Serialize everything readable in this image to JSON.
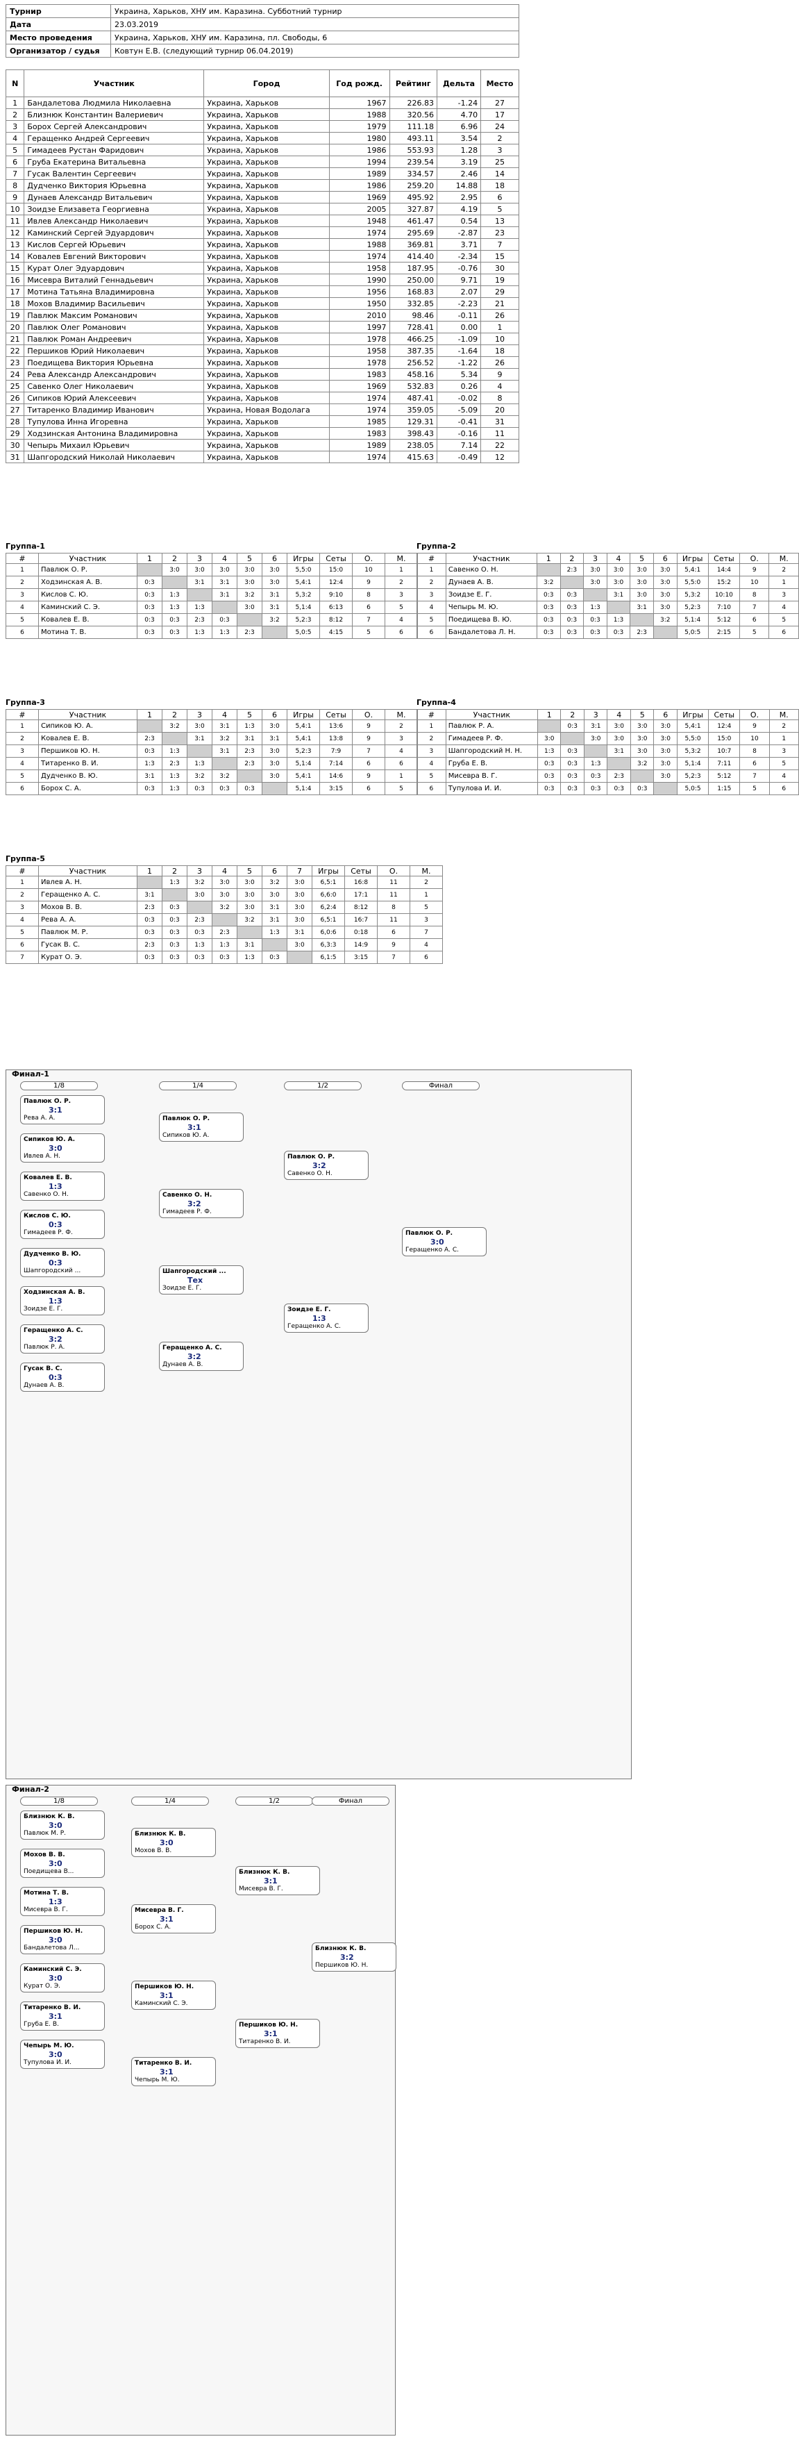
{
  "info": [
    {
      "label": "Турнир",
      "value": "Украина, Харьков, ХНУ им. Каразина. Субботний турнир"
    },
    {
      "label": "Дата",
      "value": "23.03.2019"
    },
    {
      "label": "Место проведения",
      "value": "Украина, Харьков, ХНУ им. Каразина, пл. Свободы, 6"
    },
    {
      "label": "Организатор / судья",
      "value": "Ковтун Е.В. (следующий турнир 06.04.2019)"
    }
  ],
  "columns": [
    "N",
    "Участник",
    "Город",
    "Год рожд.",
    "Рейтинг",
    "Дельта",
    "Место"
  ],
  "players": [
    [
      "1",
      "Бандалетова Людмила Николаевна",
      "Украина, Харьков",
      "1967",
      "226.83",
      "-1.24",
      "27"
    ],
    [
      "2",
      "Близнюк Константин Валериевич",
      "Украина, Харьков",
      "1988",
      "320.56",
      "4.70",
      "17"
    ],
    [
      "3",
      "Борох Сергей Александрович",
      "Украина, Харьков",
      "1979",
      "111.18",
      "6.96",
      "24"
    ],
    [
      "4",
      "Геращенко Андрей Сергеевич",
      "Украина, Харьков",
      "1980",
      "493.11",
      "3.54",
      "2"
    ],
    [
      "5",
      "Гимадеев Рустан Фаридович",
      "Украина, Харьков",
      "1986",
      "553.93",
      "1.28",
      "3"
    ],
    [
      "6",
      "Груба Екатерина Витальевна",
      "Украина, Харьков",
      "1994",
      "239.54",
      "3.19",
      "25"
    ],
    [
      "7",
      "Гусак Валентин Сергеевич",
      "Украина, Харьков",
      "1989",
      "334.57",
      "2.46",
      "14"
    ],
    [
      "8",
      "Дудченко Виктория Юрьевна",
      "Украина, Харьков",
      "1986",
      "259.20",
      "14.88",
      "18"
    ],
    [
      "9",
      "Дунаев Александр Витальевич",
      "Украина, Харьков",
      "1969",
      "495.92",
      "2.95",
      "6"
    ],
    [
      "10",
      "Зоидзе Елизавета Георгиевна",
      "Украина, Харьков",
      "2005",
      "327.87",
      "4.19",
      "5"
    ],
    [
      "11",
      "Ивлев Александр Николаевич",
      "Украина, Харьков",
      "1948",
      "461.47",
      "0.54",
      "13"
    ],
    [
      "12",
      "Каминский Сергей Эдуардович",
      "Украина, Харьков",
      "1974",
      "295.69",
      "-2.87",
      "23"
    ],
    [
      "13",
      "Кислов Сергей Юрьевич",
      "Украина, Харьков",
      "1988",
      "369.81",
      "3.71",
      "7"
    ],
    [
      "14",
      "Ковалев Евгений Викторович",
      "Украина, Харьков",
      "1974",
      "414.40",
      "-2.34",
      "15"
    ],
    [
      "15",
      "Курат Олег Эдуардович",
      "Украина, Харьков",
      "1958",
      "187.95",
      "-0.76",
      "30"
    ],
    [
      "16",
      "Мисевра Виталий Геннадьевич",
      "Украина, Харьков",
      "1990",
      "250.00",
      "9.71",
      "19"
    ],
    [
      "17",
      "Мотина Татьяна Владимировна",
      "Украина, Харьков",
      "1956",
      "168.83",
      "2.07",
      "29"
    ],
    [
      "18",
      "Мохов Владимир Васильевич",
      "Украина, Харьков",
      "1950",
      "332.85",
      "-2.23",
      "21"
    ],
    [
      "19",
      "Павлюк Максим Романович",
      "Украина, Харьков",
      "2010",
      "98.46",
      "-0.11",
      "26"
    ],
    [
      "20",
      "Павлюк Олег Романович",
      "Украина, Харьков",
      "1997",
      "728.41",
      "0.00",
      "1"
    ],
    [
      "21",
      "Павлюк Роман Андреевич",
      "Украина, Харьков",
      "1978",
      "466.25",
      "-1.09",
      "10"
    ],
    [
      "22",
      "Першиков Юрий Николаевич",
      "Украина, Харьков",
      "1958",
      "387.35",
      "-1.64",
      "18"
    ],
    [
      "23",
      "Поедищева Виктория Юрьевна",
      "Украина, Харьков",
      "1978",
      "256.52",
      "-1.22",
      "26"
    ],
    [
      "24",
      "Рева Александр Александрович",
      "Украина, Харьков",
      "1983",
      "458.16",
      "5.34",
      "9"
    ],
    [
      "25",
      "Савенко Олег Николаевич",
      "Украина, Харьков",
      "1969",
      "532.83",
      "0.26",
      "4"
    ],
    [
      "26",
      "Сипиков Юрий Алексеевич",
      "Украина, Харьков",
      "1974",
      "487.41",
      "-0.02",
      "8"
    ],
    [
      "27",
      "Титаренко Владимир Иванович",
      "Украина, Новая Водолага",
      "1974",
      "359.05",
      "-5.09",
      "20"
    ],
    [
      "28",
      "Тупулова Инна Игоревна",
      "Украина, Харьков",
      "1985",
      "129.31",
      "-0.41",
      "31"
    ],
    [
      "29",
      "Ходзинская Антонина Владимировна",
      "Украина, Харьков",
      "1983",
      "398.43",
      "-0.16",
      "11"
    ],
    [
      "30",
      "Чепырь Михаил Юрьевич",
      "Украина, Харьков",
      "1989",
      "238.05",
      "7.14",
      "22"
    ],
    [
      "31",
      "Шапгородский Николай Николаевич",
      "Украина, Харьков",
      "1974",
      "415.63",
      "-0.49",
      "12"
    ]
  ],
  "groups": [
    {
      "title": "Группа-1",
      "hdr": [
        "#",
        "Участник",
        "1",
        "2",
        "3",
        "4",
        "5",
        "6",
        "Игры",
        "Сеты",
        "О.",
        "М."
      ],
      "rows": [
        [
          "1",
          "Павлюк О. Р.",
          "",
          "3:0",
          "3:0",
          "3:0",
          "3:0",
          "3:0",
          "5,5:0",
          "15:0",
          "10",
          "1"
        ],
        [
          "2",
          "Ходзинская А. В.",
          "0:3",
          "",
          "3:1",
          "3:1",
          "3:0",
          "3:0",
          "5,4:1",
          "12:4",
          "9",
          "2"
        ],
        [
          "3",
          "Кислов С. Ю.",
          "0:3",
          "1:3",
          "",
          "3:1",
          "3:2",
          "3:1",
          "5,3:2",
          "9:10",
          "8",
          "3"
        ],
        [
          "4",
          "Каминский С. Э.",
          "0:3",
          "1:3",
          "1:3",
          "",
          "3:0",
          "3:1",
          "5,1:4",
          "6:13",
          "6",
          "5"
        ],
        [
          "5",
          "Ковалев Е. В.",
          "0:3",
          "0:3",
          "2:3",
          "0:3",
          "",
          "3:2",
          "5,2:3",
          "8:12",
          "7",
          "4"
        ],
        [
          "6",
          "Мотина Т. В.",
          "0:3",
          "0:3",
          "1:3",
          "1:3",
          "2:3",
          "",
          "5,0:5",
          "4:15",
          "5",
          "6"
        ]
      ]
    },
    {
      "title": "Группа-2",
      "hdr": [
        "#",
        "Участник",
        "1",
        "2",
        "3",
        "4",
        "5",
        "6",
        "Игры",
        "Сеты",
        "О.",
        "М."
      ],
      "rows": [
        [
          "1",
          "Савенко О. Н.",
          "",
          "2:3",
          "3:0",
          "3:0",
          "3:0",
          "3:0",
          "5,4:1",
          "14:4",
          "9",
          "2"
        ],
        [
          "2",
          "Дунаев А. В.",
          "3:2",
          "",
          "3:0",
          "3:0",
          "3:0",
          "3:0",
          "5,5:0",
          "15:2",
          "10",
          "1"
        ],
        [
          "3",
          "Зоидзе Е. Г.",
          "0:3",
          "0:3",
          "",
          "3:1",
          "3:0",
          "3:0",
          "5,3:2",
          "10:10",
          "8",
          "3"
        ],
        [
          "4",
          "Чепырь М. Ю.",
          "0:3",
          "0:3",
          "1:3",
          "",
          "3:1",
          "3:0",
          "5,2:3",
          "7:10",
          "7",
          "4"
        ],
        [
          "5",
          "Поедищева В. Ю.",
          "0:3",
          "0:3",
          "0:3",
          "1:3",
          "",
          "3:2",
          "5,1:4",
          "5:12",
          "6",
          "5"
        ],
        [
          "6",
          "Бандалетова Л. Н.",
          "0:3",
          "0:3",
          "0:3",
          "0:3",
          "2:3",
          "",
          "5,0:5",
          "2:15",
          "5",
          "6"
        ]
      ]
    },
    {
      "title": "Группа-3",
      "hdr": [
        "#",
        "Участник",
        "1",
        "2",
        "3",
        "4",
        "5",
        "6",
        "Игры",
        "Сеты",
        "О.",
        "М."
      ],
      "rows": [
        [
          "1",
          "Сипиков Ю. А.",
          "",
          "3:2",
          "3:0",
          "3:1",
          "1:3",
          "3:0",
          "5,4:1",
          "13:6",
          "9",
          "2"
        ],
        [
          "2",
          "Ковалев Е. В.",
          "2:3",
          "",
          "3:1",
          "3:2",
          "3:1",
          "3:1",
          "5,4:1",
          "13:8",
          "9",
          "3"
        ],
        [
          "3",
          "Першиков Ю. Н.",
          "0:3",
          "1:3",
          "",
          "3:1",
          "2:3",
          "3:0",
          "5,2:3",
          "7:9",
          "7",
          "4"
        ],
        [
          "4",
          "Титаренко В. И.",
          "1:3",
          "2:3",
          "1:3",
          "",
          "2:3",
          "3:0",
          "5,1:4",
          "7:14",
          "6",
          "6"
        ],
        [
          "5",
          "Дудченко В. Ю.",
          "3:1",
          "1:3",
          "3:2",
          "3:2",
          "",
          "3:0",
          "5,4:1",
          "14:6",
          "9",
          "1"
        ],
        [
          "6",
          "Борох С. А.",
          "0:3",
          "1:3",
          "0:3",
          "0:3",
          "0:3",
          "",
          "5,1:4",
          "3:15",
          "6",
          "5"
        ]
      ]
    },
    {
      "title": "Группа-4",
      "hdr": [
        "#",
        "Участник",
        "1",
        "2",
        "3",
        "4",
        "5",
        "6",
        "Игры",
        "Сеты",
        "О.",
        "М."
      ],
      "rows": [
        [
          "1",
          "Павлюк Р. А.",
          "",
          "0:3",
          "3:1",
          "3:0",
          "3:0",
          "3:0",
          "5,4:1",
          "12:4",
          "9",
          "2"
        ],
        [
          "2",
          "Гимадеев Р. Ф.",
          "3:0",
          "",
          "3:0",
          "3:0",
          "3:0",
          "3:0",
          "5,5:0",
          "15:0",
          "10",
          "1"
        ],
        [
          "3",
          "Шапгородский Н. Н.",
          "1:3",
          "0:3",
          "",
          "3:1",
          "3:0",
          "3:0",
          "5,3:2",
          "10:7",
          "8",
          "3"
        ],
        [
          "4",
          "Груба Е. В.",
          "0:3",
          "0:3",
          "1:3",
          "",
          "3:2",
          "3:0",
          "5,1:4",
          "7:11",
          "6",
          "5"
        ],
        [
          "5",
          "Мисевра В. Г.",
          "0:3",
          "0:3",
          "0:3",
          "2:3",
          "",
          "3:0",
          "5,2:3",
          "5:12",
          "7",
          "4"
        ],
        [
          "6",
          "Тупулова И. И.",
          "0:3",
          "0:3",
          "0:3",
          "0:3",
          "0:3",
          "",
          "5,0:5",
          "1:15",
          "5",
          "6"
        ]
      ]
    },
    {
      "title": "Группа-5",
      "hdr": [
        "#",
        "Участник",
        "1",
        "2",
        "3",
        "4",
        "5",
        "6",
        "7",
        "Игры",
        "Сеты",
        "О.",
        "М."
      ],
      "rows": [
        [
          "1",
          "Ивлев А. Н.",
          "",
          "1:3",
          "3:2",
          "3:0",
          "3:0",
          "3:2",
          "3:0",
          "6,5:1",
          "16:8",
          "11",
          "2"
        ],
        [
          "2",
          "Геращенко А. С.",
          "3:1",
          "",
          "3:0",
          "3:0",
          "3:0",
          "3:0",
          "3:0",
          "6,6:0",
          "17:1",
          "11",
          "1"
        ],
        [
          "3",
          "Мохов В. В.",
          "2:3",
          "0:3",
          "",
          "3:2",
          "3:0",
          "3:1",
          "3:0",
          "6,2:4",
          "8:12",
          "8",
          "5"
        ],
        [
          "4",
          "Рева А. А.",
          "0:3",
          "0:3",
          "2:3",
          "",
          "3:2",
          "3:1",
          "3:0",
          "6,5:1",
          "16:7",
          "11",
          "3"
        ],
        [
          "5",
          "Павлюк М. Р.",
          "0:3",
          "0:3",
          "0:3",
          "2:3",
          "",
          "1:3",
          "3:1",
          "6,0:6",
          "0:18",
          "6",
          "7"
        ],
        [
          "6",
          "Гусак В. С.",
          "2:3",
          "0:3",
          "1:3",
          "1:3",
          "3:1",
          "",
          "3:0",
          "6,3:3",
          "14:9",
          "9",
          "4"
        ],
        [
          "7",
          "Курат О. Э.",
          "0:3",
          "0:3",
          "0:3",
          "0:3",
          "1:3",
          "0:3",
          "",
          "6,1:5",
          "3:15",
          "7",
          "6"
        ]
      ]
    }
  ],
  "final1": {
    "title": "Финал-1",
    "rounds": [
      "1/8",
      "1/4",
      "1/2",
      "Финал"
    ],
    "matches": [
      {
        "a": "Павлюк О. Р.",
        "b": "Рева А. А.",
        "score": "3:1"
      },
      {
        "a": "Сипиков Ю. А.",
        "b": "Ивлев А. Н.",
        "score": "3:0"
      },
      {
        "a": "Ковалев Е. В.",
        "b": "Савенко О. Н.",
        "score": "1:3"
      },
      {
        "a": "Кислов С. Ю.",
        "b": "Гимадеев Р. Ф.",
        "score": "0:3"
      },
      {
        "a": "Дудченко В. Ю.",
        "b": "Шапгородский ...",
        "score": "0:3"
      },
      {
        "a": "Ходзинская А. В.",
        "b": "Зоидзе Е. Г.",
        "score": "1:3"
      },
      {
        "a": "Геращенко А. С.",
        "b": "Павлюк Р. А.",
        "score": "3:2"
      },
      {
        "a": "Гусак В. С.",
        "b": "Дунаев А. В.",
        "score": "0:3"
      },
      {
        "a": "Павлюк О. Р.",
        "b": "Сипиков Ю. А.",
        "score": "3:1"
      },
      {
        "a": "Савенко О. Н.",
        "b": "Гимадеев Р. Ф.",
        "score": "3:2"
      },
      {
        "a": "Шапгородский ...",
        "b": "Зоидзе Е. Г.",
        "score": "Тех"
      },
      {
        "a": "Геращенко А. С.",
        "b": "Дунаев А. В.",
        "score": "3:2"
      },
      {
        "a": "Павлюк О. Р.",
        "b": "Савенко О. Н.",
        "score": "3:2"
      },
      {
        "a": "Зоидзе Е. Г.",
        "b": "Геращенко А. С.",
        "score": "1:3"
      },
      {
        "a": "Павлюк О. Р.",
        "b": "Геращенко А. С.",
        "score": "3:0"
      }
    ]
  },
  "final2": {
    "title": "Финал-2",
    "rounds": [
      "1/8",
      "1/4",
      "1/2",
      "Финал"
    ],
    "matches": [
      {
        "a": "Близнюк К. В.",
        "b": "Павлюк М. Р.",
        "score": "3:0"
      },
      {
        "a": "Мохов В. В.",
        "b": "Поедищева В...",
        "score": "3:0"
      },
      {
        "a": "Мотина Т. В.",
        "b": "Мисевра В. Г.",
        "score": "1:3"
      },
      {
        "a": "Першиков Ю. Н.",
        "b": "Бандалетова Л...",
        "score": "3:0"
      },
      {
        "a": "Каминский С. Э.",
        "b": "Курат О. Э.",
        "score": "3:0"
      },
      {
        "a": "Титаренко В. И.",
        "b": "Груба Е. В.",
        "score": "3:1"
      },
      {
        "a": "Чепырь М. Ю.",
        "b": "Тупулова И. И.",
        "score": "3:0"
      },
      {
        "a": "Близнюк К. В.",
        "b": "Мохов В. В.",
        "score": "3:0"
      },
      {
        "a": "Мисевра В. Г.",
        "b": "Борох С. А.",
        "score": "3:1"
      },
      {
        "a": "Першиков Ю. Н.",
        "b": "Каминский С. Э.",
        "score": "3:1"
      },
      {
        "a": "Титаренко В. И.",
        "b": "Чепырь М. Ю.",
        "score": "3:1"
      },
      {
        "a": "Близнюк К. В.",
        "b": "Мисевра В. Г.",
        "score": "3:1"
      },
      {
        "a": "Першиков Ю. Н.",
        "b": "Титаренко В. И.",
        "score": "3:1"
      },
      {
        "a": "Близнюк К. В.",
        "b": "Першиков Ю. Н.",
        "score": "3:2"
      }
    ]
  },
  "colors": {
    "border": "#777777",
    "cyan_bg": "#e6f7fa",
    "yellow_bg": "#fbf8df",
    "gray_bg": "#f3f3f3",
    "self_cell": "#cfcfcf"
  }
}
